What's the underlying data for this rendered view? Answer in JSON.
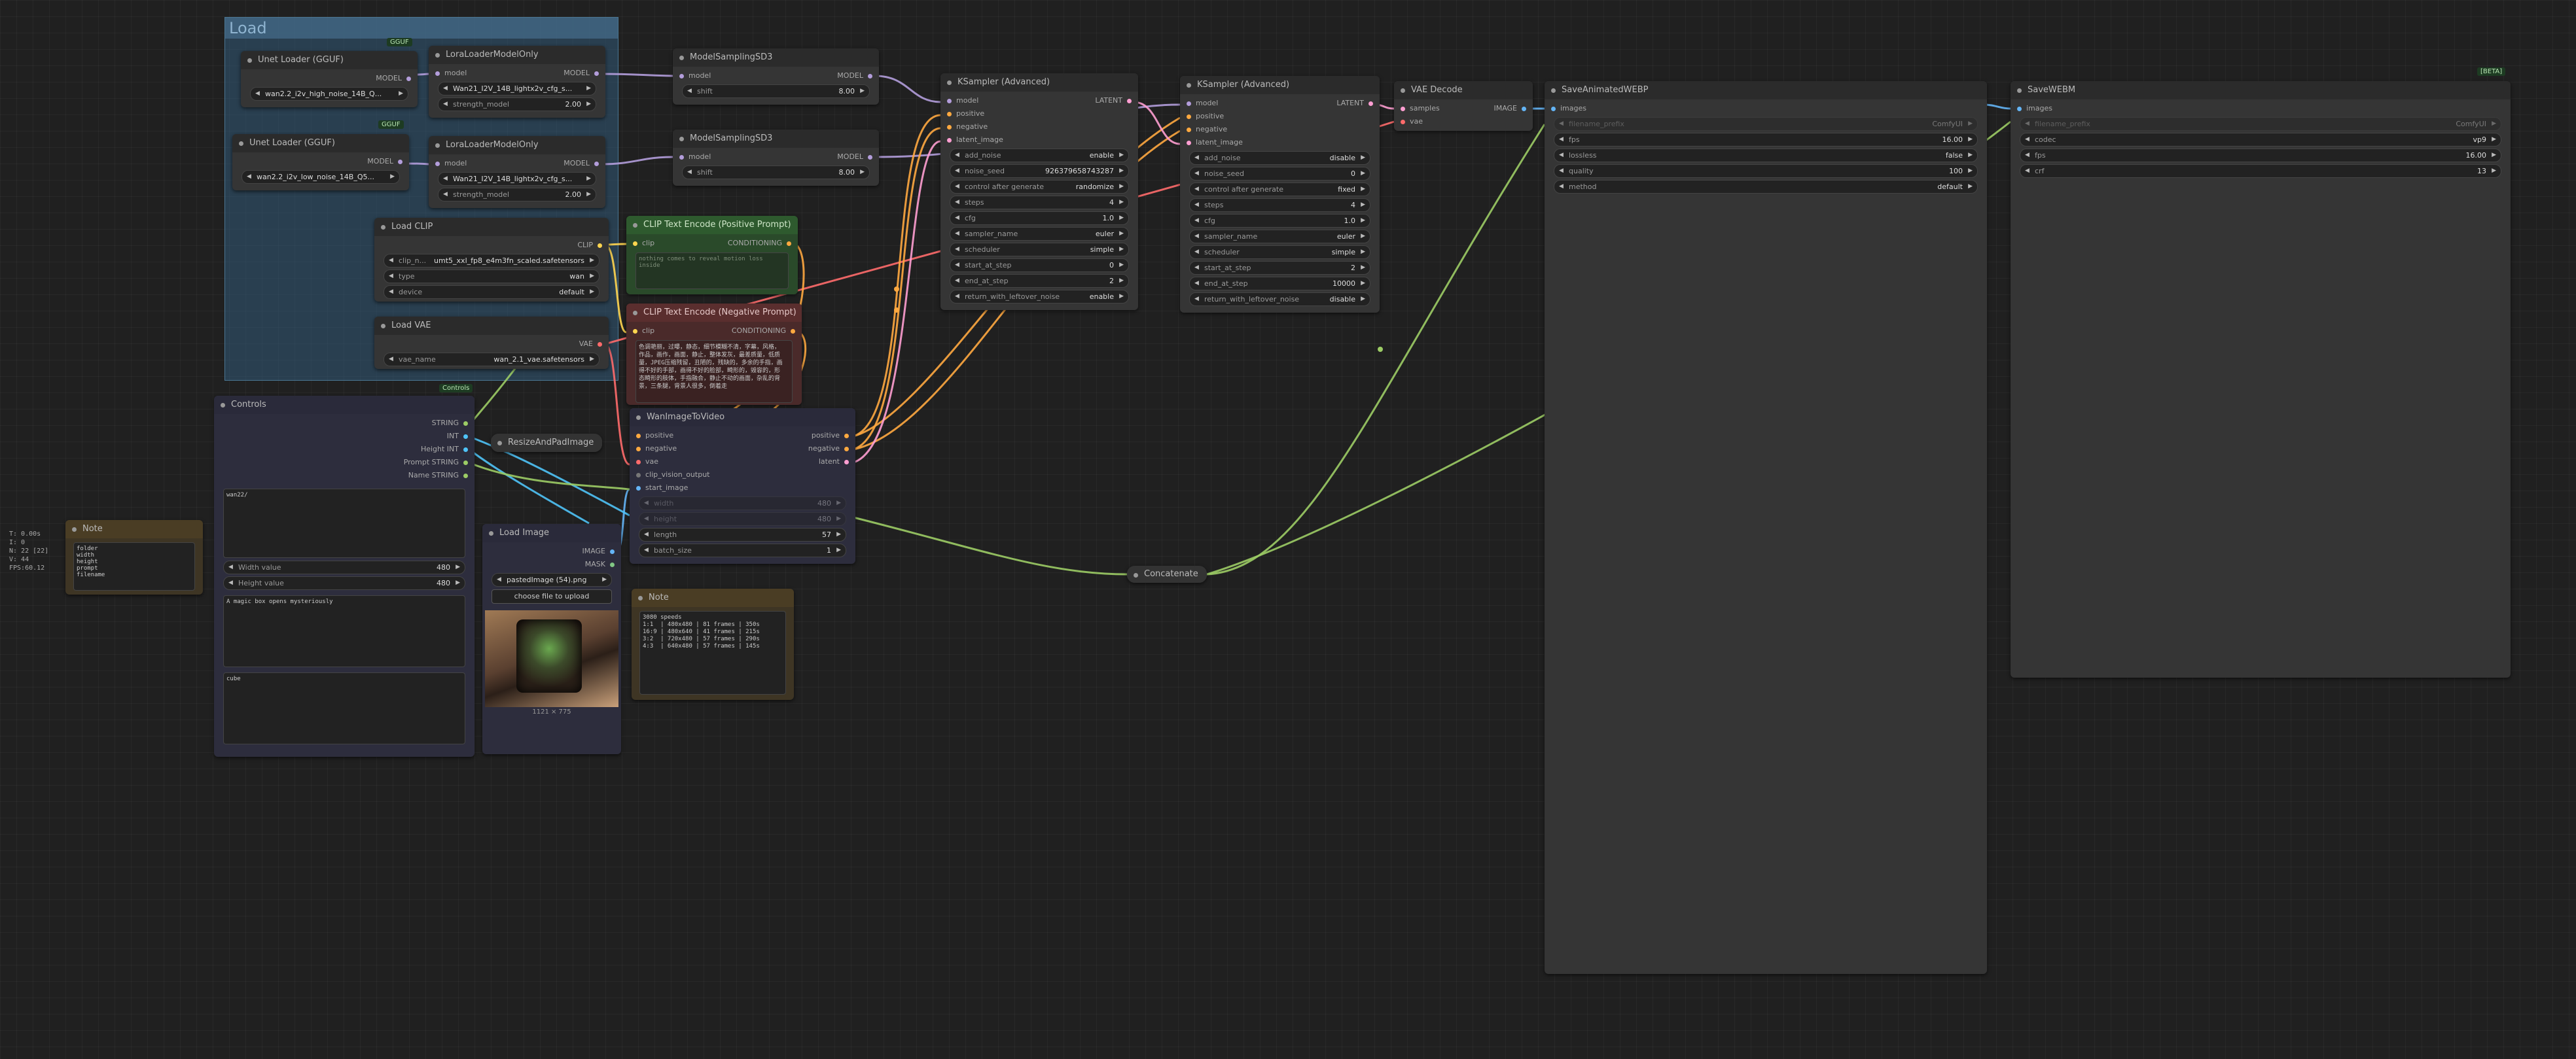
{
  "badges": {
    "gguf1": "GGUF",
    "gguf2": "GGUF",
    "controls": "Controls",
    "beta": "[BETA]"
  },
  "group": {
    "title": "Load"
  },
  "stats": [
    "T: 0.00s",
    "I: 0",
    "N: 22 [22]",
    "V: 44",
    "FPS:60.12"
  ],
  "unet1": {
    "title": "Unet Loader (GGUF)",
    "out": "MODEL",
    "widget": "wan2.2_i2v_high_noise_14B_Q..."
  },
  "unet2": {
    "title": "Unet Loader (GGUF)",
    "out": "MODEL",
    "widget": "wan2.2_i2v_low_noise_14B_Q5..."
  },
  "lora1": {
    "title": "LoraLoaderModelOnly",
    "in": "model",
    "out": "MODEL",
    "w1": "Wan21_I2V_14B_lightx2v_cfg_s...",
    "w2_label": "strength_model",
    "w2_val": "2.00"
  },
  "lora2": {
    "title": "LoraLoaderModelOnly",
    "in": "model",
    "out": "MODEL",
    "w1": "Wan21_I2V_14B_lightx2v_cfg_s...",
    "w2_label": "strength_model",
    "w2_val": "2.00"
  },
  "ms1": {
    "title": "ModelSamplingSD3",
    "in": "model",
    "out": "MODEL",
    "label": "shift",
    "val": "8.00"
  },
  "ms2": {
    "title": "ModelSamplingSD3",
    "in": "model",
    "out": "MODEL",
    "label": "shift",
    "val": "8.00"
  },
  "clip": {
    "title": "Load CLIP",
    "out": "CLIP",
    "w1_label": "clip_n...",
    "w1_val": "umt5_xxl_fp8_e4m3fn_scaled.safetensors",
    "w2_label": "type",
    "w2_val": "wan",
    "w3_label": "device",
    "w3_val": "default"
  },
  "vae": {
    "title": "Load VAE",
    "out": "VAE",
    "label": "vae_name",
    "val": "wan_2.1_vae.safetensors"
  },
  "pos": {
    "title": "CLIP Text Encode (Positive Prompt)",
    "in": "clip",
    "out": "CONDITIONING",
    "text": "nothing comes to reveal motion loss\ninside"
  },
  "neg": {
    "title": "CLIP Text Encode (Negative Prompt)",
    "in": "clip",
    "out": "CONDITIONING",
    "text": "色调艳丽，过曝，静态，细节模糊不清，字幕，风格，\n作品，画作，画面，静止，整体发灰，最差质量，低质\n量，JPEG压缩残留，丑陋的，残缺的，多余的手指，画\n得不好的手部，画得不好的脸部，畸形的，毁容的，形\n态畸形的肢体，手指融合，静止不动的画面，杂乱的背\n景，三条腿，背景人很多，倒着走"
  },
  "controls": {
    "title": "Controls",
    "outs": [
      "STRING",
      "INT",
      "Height INT",
      "Prompt STRING",
      "Name STRING"
    ],
    "text1": "wan22/",
    "w_label": "Width value",
    "w_val": "480",
    "h_label": "Height value",
    "h_val": "480",
    "text2": "A magic box opens mysteriously",
    "text3": "cube"
  },
  "resize": {
    "title": "ResizeAndPadImage"
  },
  "loadimg": {
    "title": "Load Image",
    "out1": "IMAGE",
    "out2": "MASK",
    "w_label": "image",
    "w_val": "pastedImage (54).png",
    "btn": "choose file to upload",
    "caption": "1121 × 775"
  },
  "w2v": {
    "title": "WanImageToVideo",
    "ins": [
      "positive",
      "negative",
      "vae",
      "clip_vision_output",
      "start_image"
    ],
    "outs": [
      "positive",
      "negative",
      "latent"
    ],
    "width_label": "width",
    "width_val": "480",
    "height_label": "height",
    "height_val": "480",
    "length_label": "length",
    "length_val": "57",
    "batch_label": "batch_size",
    "batch_val": "1"
  },
  "note1": {
    "title": "Note",
    "text": "folder\nwidth\nheight\nprompt\nfilename"
  },
  "note2": {
    "title": "Note",
    "text": "3080 speeds\n1:1  | 480x480 | 81 frames | 350s\n16:9 | 480x640 | 41 frames | 215s\n3:2  | 720x480 | 57 frames | 290s\n4:3  | 640x480 | 57 frames | 145s"
  },
  "ks1": {
    "title": "KSampler (Advanced)",
    "ins": [
      "model",
      "positive",
      "negative",
      "latent_image"
    ],
    "out": "LATENT",
    "widgets": [
      [
        "add_noise",
        "enable"
      ],
      [
        "noise_seed",
        "926379658743287"
      ],
      [
        "control after generate",
        "randomize"
      ],
      [
        "steps",
        "4"
      ],
      [
        "cfg",
        "1.0"
      ],
      [
        "sampler_name",
        "euler"
      ],
      [
        "scheduler",
        "simple"
      ],
      [
        "start_at_step",
        "0"
      ],
      [
        "end_at_step",
        "2"
      ],
      [
        "return_with_leftover_noise",
        "enable"
      ]
    ]
  },
  "ks2": {
    "title": "KSampler (Advanced)",
    "ins": [
      "model",
      "positive",
      "negative",
      "latent_image"
    ],
    "out": "LATENT",
    "widgets": [
      [
        "add_noise",
        "disable"
      ],
      [
        "noise_seed",
        "0"
      ],
      [
        "control after generate",
        "fixed"
      ],
      [
        "steps",
        "4"
      ],
      [
        "cfg",
        "1.0"
      ],
      [
        "sampler_name",
        "euler"
      ],
      [
        "scheduler",
        "simple"
      ],
      [
        "start_at_step",
        "2"
      ],
      [
        "end_at_step",
        "10000"
      ],
      [
        "return_with_leftover_noise",
        "disable"
      ]
    ]
  },
  "vaedec": {
    "title": "VAE Decode",
    "in1": "samples",
    "in2": "vae",
    "out": "IMAGE"
  },
  "webp": {
    "title": "SaveAnimatedWEBP",
    "in": "images",
    "prefix_label": "filename_prefix",
    "prefix_val": "ComfyUI",
    "widgets": [
      [
        "fps",
        "16.00"
      ],
      [
        "lossless",
        "false"
      ],
      [
        "quality",
        "100"
      ],
      [
        "method",
        "default"
      ]
    ]
  },
  "webm": {
    "title": "SaveWEBM",
    "in": "images",
    "prefix_label": "filename_prefix",
    "prefix_val": "ComfyUI",
    "widgets": [
      [
        "codec",
        "vp9"
      ],
      [
        "fps",
        "16.00"
      ],
      [
        "crf",
        "13"
      ]
    ]
  },
  "concat": {
    "title": "Concatenate"
  }
}
